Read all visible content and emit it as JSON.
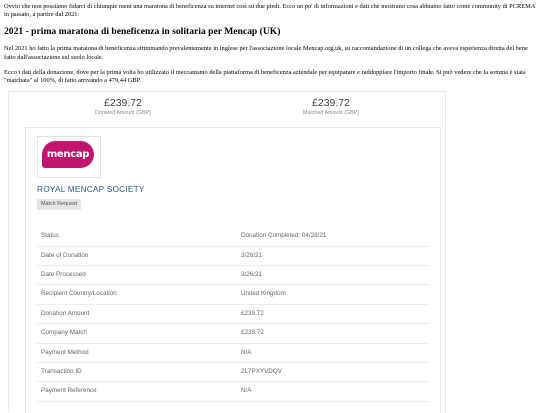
{
  "article": {
    "intro": "Ovvio che non possiamo fidarci di chiunque meni una maratona di beneficenza su internet così su due piedi. Ecco un po' di informazioni e dati che mostrano cosa abbiamo fatto come community di PCREMA in passato, a partire dal 2021:",
    "heading": "2021 - prima maratona di beneficenza in solitaria per Mencap (UK)",
    "para1": "Nel 2021 ho fatto la prima maratona di beneficenza strimmando prevalentemente in inglese per l'associazione locale Mencap.org.uk, su raccomandazione di un collega che aveva esperienza diretta del bene fatto dall'associazione sul suolo locale.",
    "para2": "Ecco i dati della donazione, dove per la prima volta ho utilizzato il meccanismo della piattaforma di beneficenza aziendale per equiparare e raddoppiare l'importo finale. Si può vedere che la somma è stata \"matchata\" al 100%, di fatto arrivando a 479,44 GBP."
  },
  "summary": {
    "donated_amount": "£239.72",
    "donated_label": "Donated Amount (GBP)",
    "matched_amount": "£239.72",
    "matched_label": "Matched Amount (GBP)"
  },
  "org": {
    "logo_text": "mencap",
    "name": "ROYAL MENCAP SOCIETY",
    "tag": "Match Request"
  },
  "rows": [
    {
      "key": "Status",
      "value": "Donation Completed: 04/28/21"
    },
    {
      "key": "Date of Donation",
      "value": "3/26/21"
    },
    {
      "key": "Date Processed",
      "value": "3/26/21"
    },
    {
      "key": "Recipient Country/Location",
      "value": "United Kingdom"
    },
    {
      "key": "Donation Amount",
      "value": "£239.72"
    },
    {
      "key": "Company Match",
      "value": "£239.72"
    },
    {
      "key": "Payment Method",
      "value": "N/A"
    },
    {
      "key": "Transaction ID",
      "value": "2L7PXYVDQV"
    },
    {
      "key": "Payment Reference",
      "value": "N/A"
    }
  ],
  "colors": {
    "logo_bg": "#c2166e",
    "org_name": "#2a5a8c"
  }
}
